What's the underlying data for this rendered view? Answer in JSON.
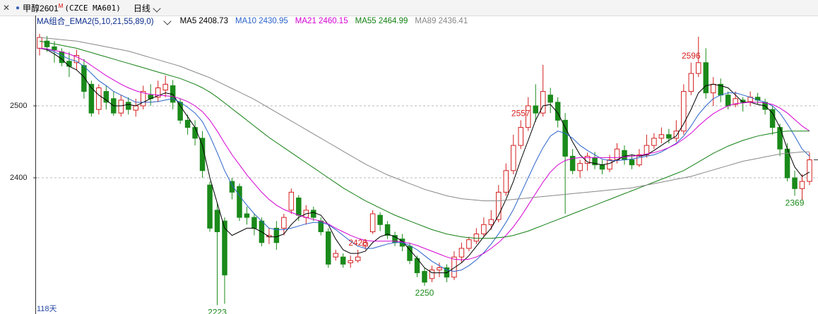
{
  "toolbar": {
    "close_icon": "close-icon",
    "symbol": "甲醇2601",
    "symbol_mark": "M",
    "code": "(CZCE MA601)",
    "period": "日线"
  },
  "ma_bar": {
    "combo": "MA组合_EMA2(5,10,21,55,89,0)",
    "items": [
      {
        "label": "MA5 2408.73",
        "color": "#000000"
      },
      {
        "label": "MA10 2430.95",
        "color": "#2a63c9"
      },
      {
        "label": "MA21 2460.15",
        "color": "#d400d4"
      },
      {
        "label": "MA55 2464.99",
        "color": "#138013"
      },
      {
        "label": "MA89 2436.41",
        "color": "#888888"
      }
    ]
  },
  "footer": {
    "days": "118天"
  },
  "chart_data": {
    "type": "candlestick",
    "title": "",
    "xlabel": "",
    "ylabel": "",
    "y_ticks": [
      2400,
      2500
    ],
    "y_tick_labels": [
      "2400",
      "2500"
    ],
    "ylim": [
      2214,
      2615
    ],
    "grid": "dashed horizontal",
    "colors": {
      "up": "#d42020",
      "down": "#1a8a1a"
    },
    "annotations": [
      {
        "label": "2596",
        "index": 88,
        "kind": "high"
      },
      {
        "label": "2557",
        "index": 65,
        "kind": "high"
      },
      {
        "label": "2428",
        "index": 43,
        "kind": "high"
      },
      {
        "label": "2223",
        "index": 24,
        "kind": "low"
      },
      {
        "label": "2250",
        "index": 52,
        "kind": "low"
      },
      {
        "label": "2369",
        "index": 102,
        "kind": "low"
      }
    ],
    "candles": [
      [
        2580,
        2595,
        2600,
        2570
      ],
      [
        2590,
        2582,
        2597,
        2575
      ],
      [
        2582,
        2578,
        2590,
        2560
      ],
      [
        2575,
        2560,
        2580,
        2555
      ],
      [
        2562,
        2555,
        2575,
        2540
      ],
      [
        2560,
        2570,
        2578,
        2550
      ],
      [
        2556,
        2520,
        2565,
        2510
      ],
      [
        2530,
        2490,
        2535,
        2485
      ],
      [
        2495,
        2525,
        2530,
        2488
      ],
      [
        2520,
        2505,
        2528,
        2495
      ],
      [
        2510,
        2490,
        2520,
        2486
      ],
      [
        2490,
        2508,
        2515,
        2485
      ],
      [
        2505,
        2495,
        2512,
        2488
      ],
      [
        2494,
        2500,
        2510,
        2485
      ],
      [
        2500,
        2520,
        2528,
        2495
      ],
      [
        2515,
        2510,
        2530,
        2500
      ],
      [
        2512,
        2525,
        2535,
        2505
      ],
      [
        2522,
        2530,
        2542,
        2512
      ],
      [
        2528,
        2505,
        2536,
        2495
      ],
      [
        2505,
        2480,
        2510,
        2475
      ],
      [
        2480,
        2470,
        2488,
        2460
      ],
      [
        2470,
        2455,
        2480,
        2445
      ],
      [
        2455,
        2410,
        2465,
        2400
      ],
      [
        2390,
        2330,
        2395,
        2325
      ],
      [
        2355,
        2325,
        2365,
        2223
      ],
      [
        2340,
        2265,
        2345,
        2225
      ],
      [
        2395,
        2380,
        2400,
        2370
      ],
      [
        2388,
        2345,
        2392,
        2340
      ],
      [
        2350,
        2345,
        2360,
        2335
      ],
      [
        2345,
        2330,
        2350,
        2320
      ],
      [
        2340,
        2310,
        2345,
        2305
      ],
      [
        2318,
        2320,
        2330,
        2308
      ],
      [
        2330,
        2310,
        2340,
        2300
      ],
      [
        2330,
        2345,
        2350,
        2320
      ],
      [
        2355,
        2380,
        2385,
        2350
      ],
      [
        2372,
        2348,
        2376,
        2340
      ],
      [
        2345,
        2355,
        2362,
        2335
      ],
      [
        2355,
        2345,
        2360,
        2340
      ],
      [
        2340,
        2325,
        2345,
        2320
      ],
      [
        2325,
        2280,
        2330,
        2275
      ],
      [
        2290,
        2295,
        2300,
        2285
      ],
      [
        2290,
        2280,
        2295,
        2275
      ],
      [
        2282,
        2285,
        2292,
        2275
      ],
      [
        2285,
        2290,
        2300,
        2282
      ],
      [
        2305,
        2310,
        2315,
        2300
      ],
      [
        2325,
        2350,
        2355,
        2322
      ],
      [
        2348,
        2335,
        2352,
        2326
      ],
      [
        2335,
        2320,
        2340,
        2315
      ],
      [
        2320,
        2310,
        2325,
        2305
      ],
      [
        2315,
        2305,
        2322,
        2298
      ],
      [
        2305,
        2285,
        2310,
        2280
      ],
      [
        2288,
        2268,
        2292,
        2262
      ],
      [
        2270,
        2255,
        2275,
        2250
      ],
      [
        2260,
        2272,
        2278,
        2255
      ],
      [
        2272,
        2275,
        2282,
        2262
      ],
      [
        2275,
        2262,
        2280,
        2255
      ],
      [
        2262,
        2290,
        2298,
        2258
      ],
      [
        2290,
        2302,
        2310,
        2282
      ],
      [
        2302,
        2314,
        2318,
        2298
      ],
      [
        2312,
        2322,
        2330,
        2308
      ],
      [
        2322,
        2335,
        2345,
        2318
      ],
      [
        2335,
        2342,
        2355,
        2328
      ],
      [
        2342,
        2380,
        2390,
        2338
      ],
      [
        2380,
        2410,
        2420,
        2375
      ],
      [
        2410,
        2445,
        2460,
        2405
      ],
      [
        2445,
        2470,
        2480,
        2440
      ],
      [
        2470,
        2500,
        2512,
        2465
      ],
      [
        2500,
        2490,
        2530,
        2478
      ],
      [
        2490,
        2520,
        2557,
        2485
      ],
      [
        2515,
        2505,
        2525,
        2490
      ],
      [
        2505,
        2480,
        2512,
        2470
      ],
      [
        2480,
        2430,
        2490,
        2350
      ],
      [
        2430,
        2410,
        2440,
        2405
      ],
      [
        2410,
        2420,
        2425,
        2400
      ],
      [
        2420,
        2430,
        2435,
        2410
      ],
      [
        2428,
        2418,
        2436,
        2412
      ],
      [
        2418,
        2412,
        2425,
        2405
      ],
      [
        2412,
        2425,
        2432,
        2408
      ],
      [
        2425,
        2440,
        2448,
        2420
      ],
      [
        2438,
        2425,
        2445,
        2418
      ],
      [
        2425,
        2418,
        2432,
        2412
      ],
      [
        2418,
        2432,
        2440,
        2415
      ],
      [
        2432,
        2445,
        2460,
        2428
      ],
      [
        2445,
        2455,
        2462,
        2440
      ],
      [
        2455,
        2460,
        2470,
        2448
      ],
      [
        2460,
        2455,
        2468,
        2448
      ],
      [
        2455,
        2465,
        2480,
        2450
      ],
      [
        2465,
        2520,
        2530,
        2460
      ],
      [
        2520,
        2545,
        2560,
        2515
      ],
      [
        2545,
        2560,
        2596,
        2540
      ],
      [
        2560,
        2518,
        2580,
        2510
      ],
      [
        2518,
        2530,
        2540,
        2500
      ],
      [
        2530,
        2515,
        2538,
        2505
      ],
      [
        2515,
        2500,
        2520,
        2495
      ],
      [
        2502,
        2510,
        2520,
        2498
      ],
      [
        2508,
        2505,
        2512,
        2492
      ],
      [
        2506,
        2512,
        2520,
        2500
      ],
      [
        2512,
        2508,
        2518,
        2502
      ],
      [
        2505,
        2495,
        2510,
        2488
      ],
      [
        2495,
        2470,
        2500,
        2460
      ],
      [
        2470,
        2440,
        2475,
        2430
      ],
      [
        2440,
        2400,
        2448,
        2395
      ],
      [
        2400,
        2385,
        2410,
        2375
      ],
      [
        2385,
        2395,
        2405,
        2369
      ],
      [
        2395,
        2425,
        2435,
        2390
      ]
    ],
    "ma_lines": [
      {
        "name": "MA5",
        "color": "#000000",
        "values": [
          2580,
          2578,
          2572,
          2565,
          2555,
          2550,
          2540,
          2525,
          2515,
          2508,
          2500,
          2500,
          2502,
          2500,
          2505,
          2510,
          2514,
          2518,
          2516,
          2500,
          2485,
          2470,
          2445,
          2400,
          2365,
          2330,
          2320,
          2325,
          2330,
          2330,
          2325,
          2318,
          2318,
          2322,
          2335,
          2345,
          2350,
          2352,
          2348,
          2335,
          2315,
          2300,
          2295,
          2295,
          2298,
          2310,
          2318,
          2322,
          2318,
          2312,
          2300,
          2288,
          2275,
          2268,
          2268,
          2268,
          2275,
          2282,
          2292,
          2305,
          2318,
          2330,
          2348,
          2370,
          2395,
          2425,
          2452,
          2480,
          2500,
          2502,
          2490,
          2470,
          2450,
          2432,
          2422,
          2420,
          2418,
          2420,
          2425,
          2430,
          2432,
          2430,
          2432,
          2438,
          2445,
          2452,
          2458,
          2475,
          2495,
          2518,
          2528,
          2530,
          2528,
          2525,
          2515,
          2505,
          2505,
          2502,
          2500,
          2490,
          2470,
          2440,
          2415,
          2402,
          2408
        ]
      },
      {
        "name": "MA10",
        "color": "#2a63c9",
        "values": [
          2580,
          2579,
          2575,
          2570,
          2565,
          2562,
          2555,
          2545,
          2535,
          2528,
          2520,
          2515,
          2510,
          2505,
          2505,
          2505,
          2506,
          2508,
          2510,
          2505,
          2498,
          2490,
          2478,
          2458,
          2435,
          2410,
          2390,
          2375,
          2362,
          2350,
          2340,
          2330,
          2328,
          2328,
          2330,
          2333,
          2336,
          2338,
          2338,
          2335,
          2328,
          2320,
          2312,
          2305,
          2302,
          2302,
          2305,
          2308,
          2310,
          2310,
          2306,
          2300,
          2292,
          2284,
          2278,
          2272,
          2270,
          2272,
          2278,
          2286,
          2296,
          2308,
          2322,
          2338,
          2356,
          2378,
          2400,
          2422,
          2442,
          2458,
          2465,
          2462,
          2455,
          2445,
          2438,
          2432,
          2426,
          2424,
          2424,
          2425,
          2426,
          2428,
          2430,
          2432,
          2436,
          2442,
          2448,
          2458,
          2472,
          2488,
          2500,
          2510,
          2515,
          2518,
          2518,
          2515,
          2512,
          2508,
          2505,
          2500,
          2490,
          2475,
          2458,
          2440,
          2430
        ]
      },
      {
        "name": "MA21",
        "color": "#d400d4",
        "values": [
          2580,
          2579,
          2577,
          2575,
          2572,
          2568,
          2563,
          2556,
          2549,
          2542,
          2536,
          2530,
          2525,
          2521,
          2518,
          2516,
          2515,
          2514,
          2513,
          2510,
          2506,
          2500,
          2492,
          2480,
          2465,
          2448,
          2432,
          2418,
          2404,
          2392,
          2380,
          2370,
          2362,
          2356,
          2352,
          2348,
          2345,
          2342,
          2340,
          2336,
          2330,
          2325,
          2320,
          2316,
          2313,
          2312,
          2312,
          2312,
          2312,
          2311,
          2309,
          2306,
          2302,
          2298,
          2294,
          2290,
          2287,
          2286,
          2287,
          2290,
          2295,
          2302,
          2310,
          2320,
          2332,
          2346,
          2362,
          2378,
          2394,
          2408,
          2418,
          2424,
          2427,
          2428,
          2428,
          2428,
          2428,
          2428,
          2428,
          2429,
          2430,
          2431,
          2433,
          2435,
          2438,
          2442,
          2447,
          2454,
          2462,
          2472,
          2481,
          2489,
          2495,
          2500,
          2503,
          2504,
          2505,
          2505,
          2504,
          2502,
          2497,
          2490,
          2481,
          2472,
          2465
        ]
      },
      {
        "name": "MA55",
        "color": "#138013",
        "values": [
          2590,
          2588,
          2586,
          2584,
          2582,
          2580,
          2577,
          2574,
          2571,
          2568,
          2565,
          2562,
          2559,
          2556,
          2553,
          2550,
          2547,
          2544,
          2541,
          2538,
          2534,
          2530,
          2525,
          2519,
          2512,
          2504,
          2496,
          2488,
          2480,
          2472,
          2464,
          2456,
          2449,
          2442,
          2435,
          2428,
          2421,
          2414,
          2407,
          2400,
          2393,
          2386,
          2380,
          2374,
          2368,
          2363,
          2358,
          2353,
          2348,
          2344,
          2340,
          2336,
          2332,
          2328,
          2325,
          2322,
          2320,
          2318,
          2317,
          2316,
          2316,
          2316,
          2317,
          2318,
          2320,
          2323,
          2326,
          2330,
          2334,
          2338,
          2342,
          2346,
          2350,
          2354,
          2358,
          2362,
          2366,
          2370,
          2374,
          2378,
          2382,
          2386,
          2390,
          2394,
          2398,
          2402,
          2406,
          2410,
          2416,
          2422,
          2428,
          2434,
          2439,
          2444,
          2448,
          2452,
          2455,
          2458,
          2460,
          2462,
          2464,
          2465,
          2465,
          2465,
          2465
        ]
      },
      {
        "name": "MA89",
        "color": "#888888",
        "values": [
          2595,
          2594,
          2593,
          2592,
          2591,
          2590,
          2588,
          2586,
          2584,
          2582,
          2580,
          2578,
          2576,
          2573,
          2570,
          2567,
          2564,
          2561,
          2558,
          2555,
          2551,
          2547,
          2543,
          2539,
          2534,
          2529,
          2524,
          2519,
          2514,
          2509,
          2503,
          2497,
          2491,
          2485,
          2479,
          2473,
          2467,
          2461,
          2455,
          2449,
          2443,
          2437,
          2431,
          2425,
          2419,
          2414,
          2409,
          2404,
          2400,
          2396,
          2392,
          2388,
          2384,
          2381,
          2378,
          2375,
          2373,
          2371,
          2370,
          2369,
          2368,
          2368,
          2368,
          2369,
          2370,
          2371,
          2372,
          2373,
          2374,
          2375,
          2376,
          2377,
          2378,
          2379,
          2380,
          2381,
          2382,
          2383,
          2384,
          2385,
          2386,
          2388,
          2390,
          2392,
          2394,
          2396,
          2398,
          2400,
          2402,
          2405,
          2408,
          2411,
          2414,
          2417,
          2420,
          2423,
          2425,
          2427,
          2429,
          2431,
          2433,
          2434,
          2435,
          2436,
          2436
        ]
      }
    ]
  }
}
